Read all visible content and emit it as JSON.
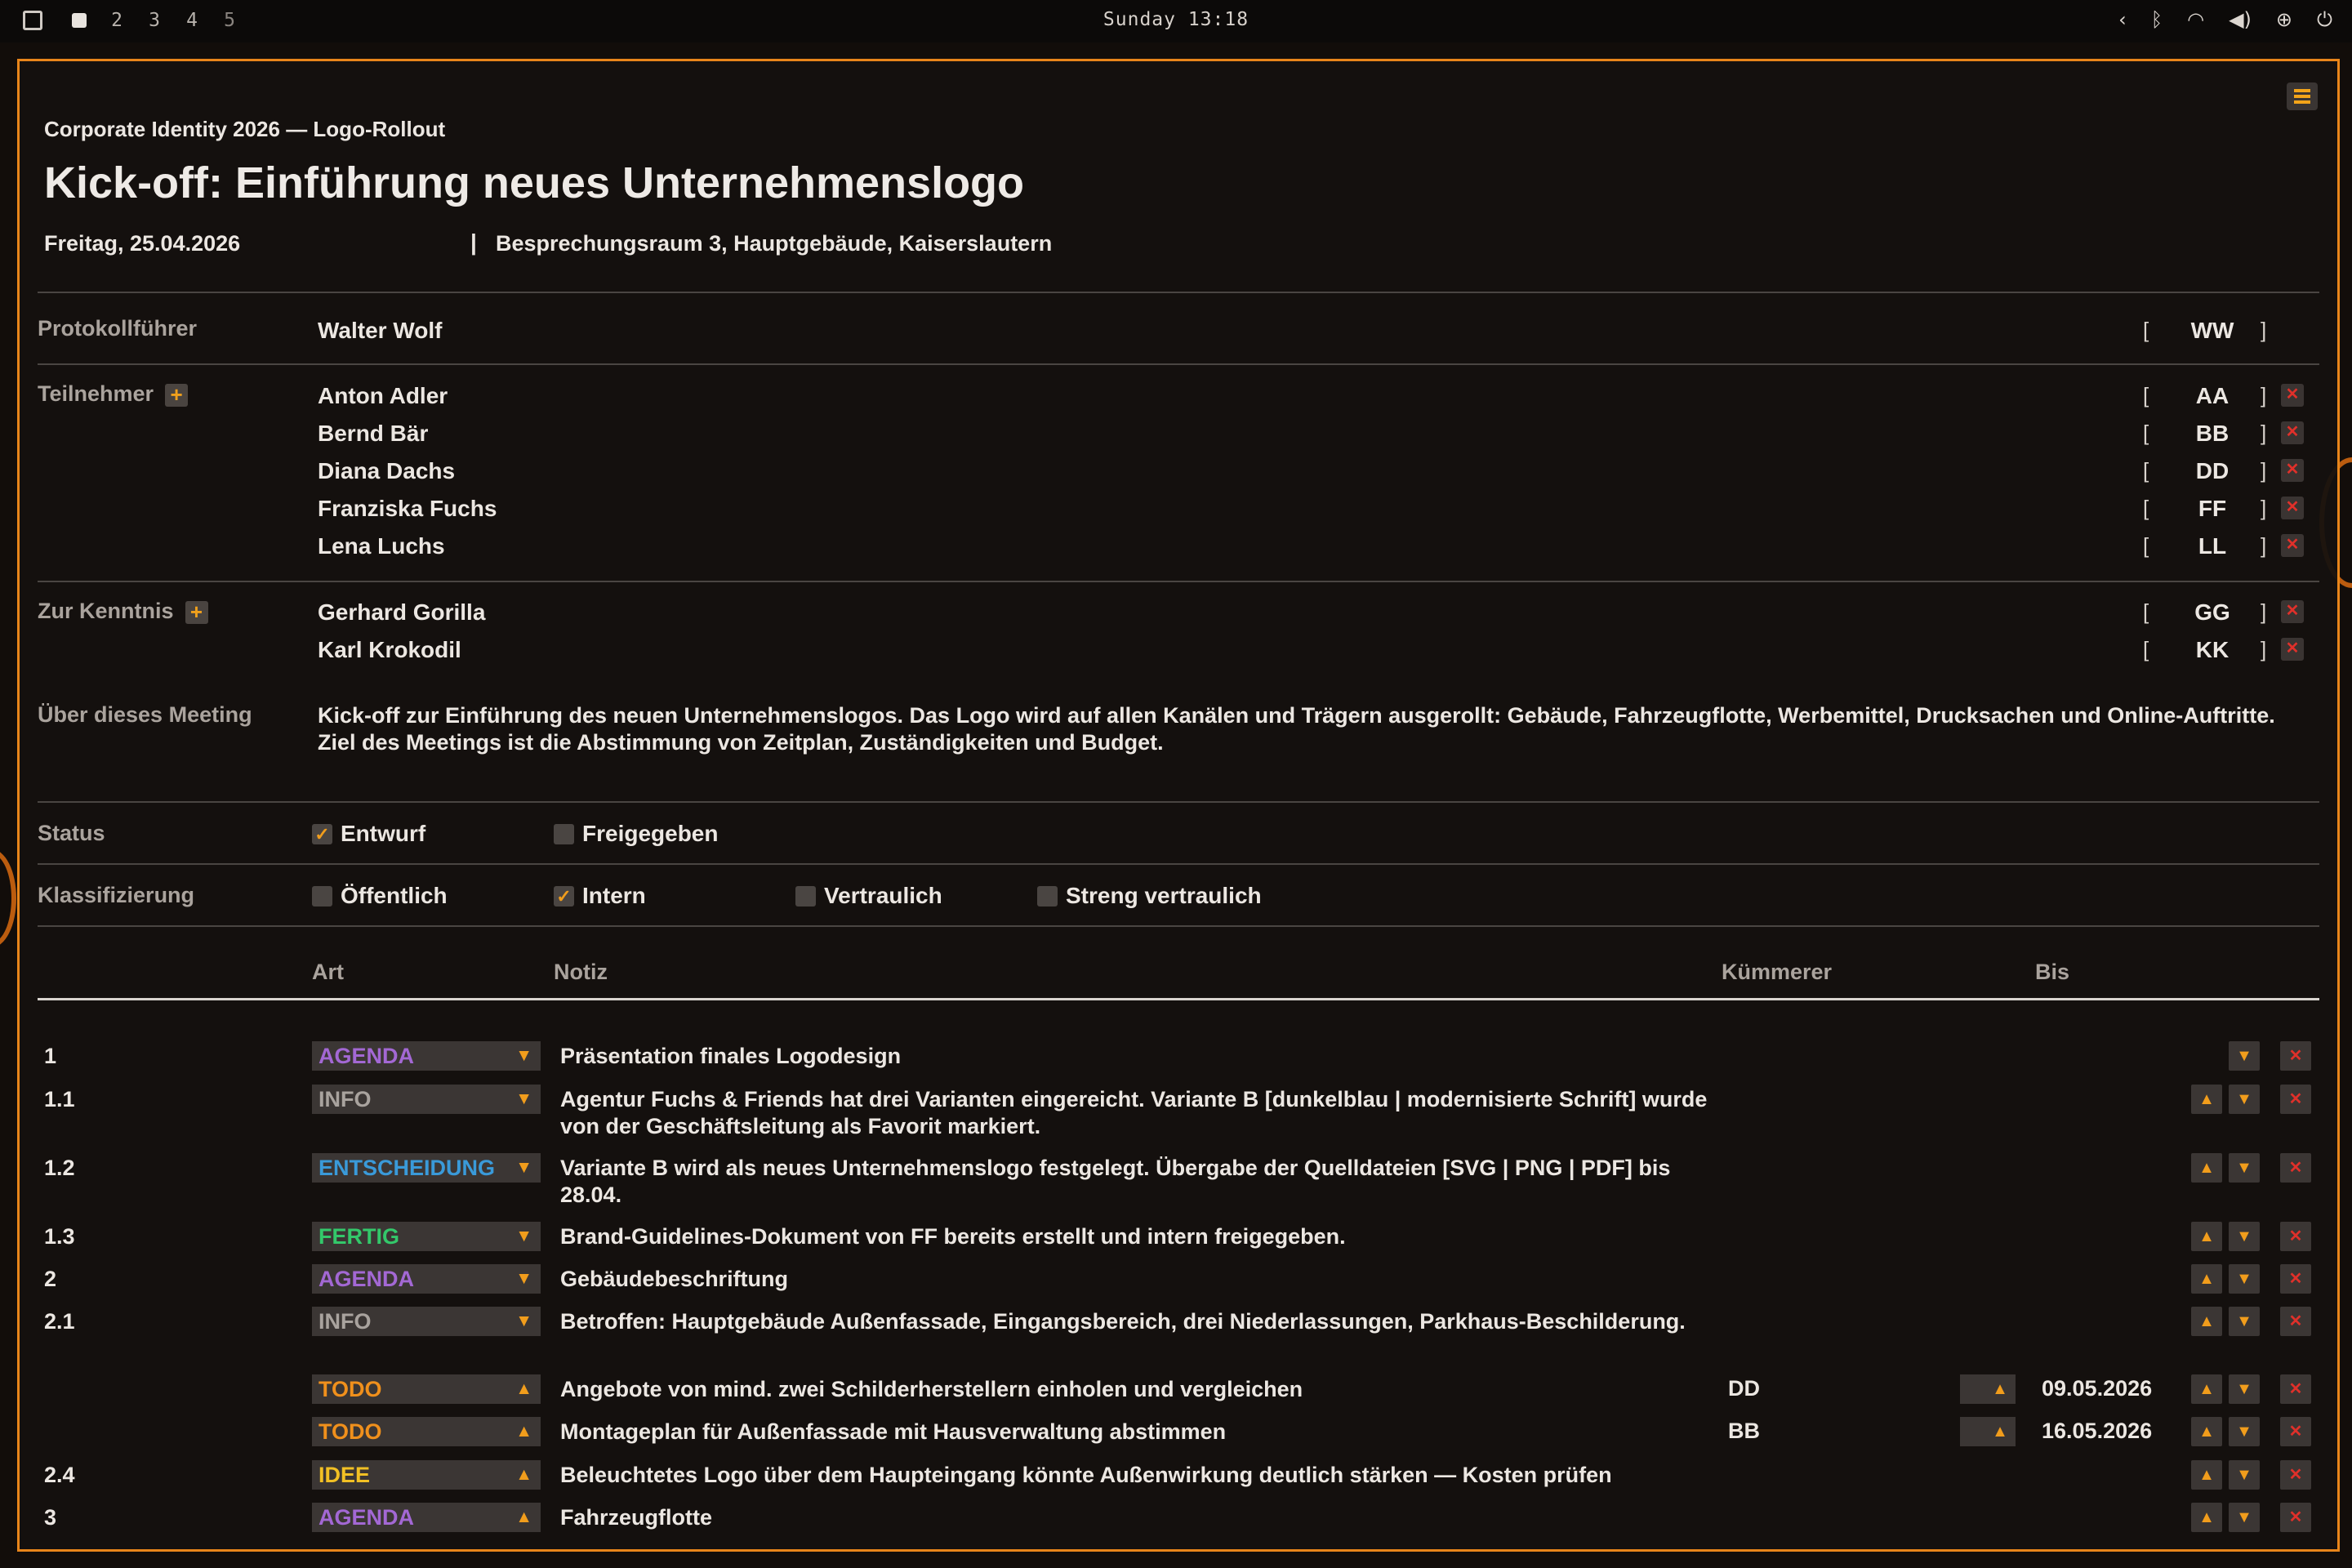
{
  "topbar": {
    "workspaces": [
      "2",
      "3",
      "4",
      "5"
    ],
    "clock": "Sunday 13:18",
    "tray_icons": [
      "chevron-left-icon",
      "bluetooth-icon",
      "wifi-icon",
      "volume-icon",
      "settings-icon",
      "power-icon"
    ]
  },
  "colors": {
    "accent": "#e8851a",
    "agenda": "#a368d4",
    "info": "#a9a39e",
    "entscheidung": "#3a9ad9",
    "fertig": "#33c86a",
    "todo": "#f0901c",
    "idee": "#f2c024",
    "delete": "#e0302a"
  },
  "doc": {
    "project": "Corporate Identity 2026 — Logo-Rollout",
    "title": "Kick-off: Einführung neues Unternehmenslogo",
    "date": "Freitag, 25.04.2026",
    "separator": "|",
    "place": "Besprechungsraum 3, Hauptgebäude, Kaiserslautern"
  },
  "protocol": {
    "label": "Protokollführer",
    "name": "Walter Wolf",
    "initials": "WW"
  },
  "participants": {
    "label": "Teilnehmer",
    "people": [
      {
        "name": "Anton Adler",
        "initials": "AA"
      },
      {
        "name": "Bernd Bär",
        "initials": "BB"
      },
      {
        "name": "Diana Dachs",
        "initials": "DD"
      },
      {
        "name": "Franziska Fuchs",
        "initials": "FF"
      },
      {
        "name": "Lena Luchs",
        "initials": "LL"
      }
    ]
  },
  "cc": {
    "label": "Zur Kenntnis",
    "people": [
      {
        "name": "Gerhard Gorilla",
        "initials": "GG"
      },
      {
        "name": "Karl Krokodil",
        "initials": "KK"
      }
    ]
  },
  "brackets": {
    "open": "[",
    "close": "]"
  },
  "symbols": {
    "plus": "+",
    "close": "✕",
    "up": "▲",
    "down": "▼",
    "check": "✓"
  },
  "about": {
    "label": "Über dieses Meeting",
    "text": "Kick-off zur Einführung des neuen Unternehmenslogos. Das Logo wird auf allen Kanälen und Trägern ausgerollt: Gebäude, Fahrzeugflotte, Werbemittel, Drucksachen und Online-Auftritte. Ziel des Meetings ist die Abstimmung von Zeitplan, Zuständigkeiten und Budget."
  },
  "status": {
    "label": "Status",
    "options": [
      {
        "label": "Entwurf",
        "checked": true
      },
      {
        "label": "Freigegeben",
        "checked": false
      }
    ]
  },
  "classification": {
    "label": "Klassifizierung",
    "options": [
      {
        "label": "Öffentlich",
        "checked": false
      },
      {
        "label": "Intern",
        "checked": true
      },
      {
        "label": "Vertraulich",
        "checked": false
      },
      {
        "label": "Streng vertraulich",
        "checked": false
      }
    ]
  },
  "table": {
    "headers": {
      "art": "Art",
      "notiz": "Notiz",
      "kuemmerer": "Kümmerer",
      "bis": "Bis"
    },
    "rows": [
      {
        "num": "1",
        "art": "AGENDA",
        "note": "Präsentation finales Logodesign",
        "kum": "",
        "bis": ""
      },
      {
        "num": "1.1",
        "art": "INFO",
        "note": "Agentur Fuchs & Friends hat drei Varianten eingereicht. Variante B [dunkelblau | modernisierte Schrift] wurde von der Geschäftsleitung als Favorit markiert.",
        "kum": "",
        "bis": ""
      },
      {
        "num": "1.2",
        "art": "ENTSCHEIDUNG",
        "note": "Variante B wird als neues Unternehmenslogo festgelegt. Übergabe der Quelldateien [SVG | PNG | PDF] bis 28.04.",
        "kum": "",
        "bis": ""
      },
      {
        "num": "1.3",
        "art": "FERTIG",
        "note": "Brand-Guidelines-Dokument von FF bereits erstellt und intern freigegeben.",
        "kum": "",
        "bis": ""
      },
      {
        "num": "2",
        "art": "AGENDA",
        "note": "Gebäudebeschriftung",
        "kum": "",
        "bis": ""
      },
      {
        "num": "2.1",
        "art": "INFO",
        "note": "Betroffen: Hauptgebäude Außenfassade, Eingangsbereich, drei Niederlassungen, Parkhaus-Beschilderung.",
        "kum": "",
        "bis": ""
      },
      {
        "num": "",
        "art": "TODO",
        "note": "Angebote von mind. zwei Schilderherstellern einholen und vergleichen",
        "kum": "DD",
        "bis": "09.05.2026"
      },
      {
        "num": "",
        "art": "TODO",
        "note": "Montageplan für Außenfassade mit Hausverwaltung abstimmen",
        "kum": "BB",
        "bis": "16.05.2026"
      },
      {
        "num": "2.4",
        "art": "IDEE",
        "note": "Beleuchtetes Logo über dem Haupteingang könnte Außenwirkung deutlich stärken — Kosten prüfen",
        "kum": "",
        "bis": ""
      },
      {
        "num": "3",
        "art": "AGENDA",
        "note": "Fahrzeugflotte",
        "kum": "",
        "bis": ""
      }
    ]
  }
}
